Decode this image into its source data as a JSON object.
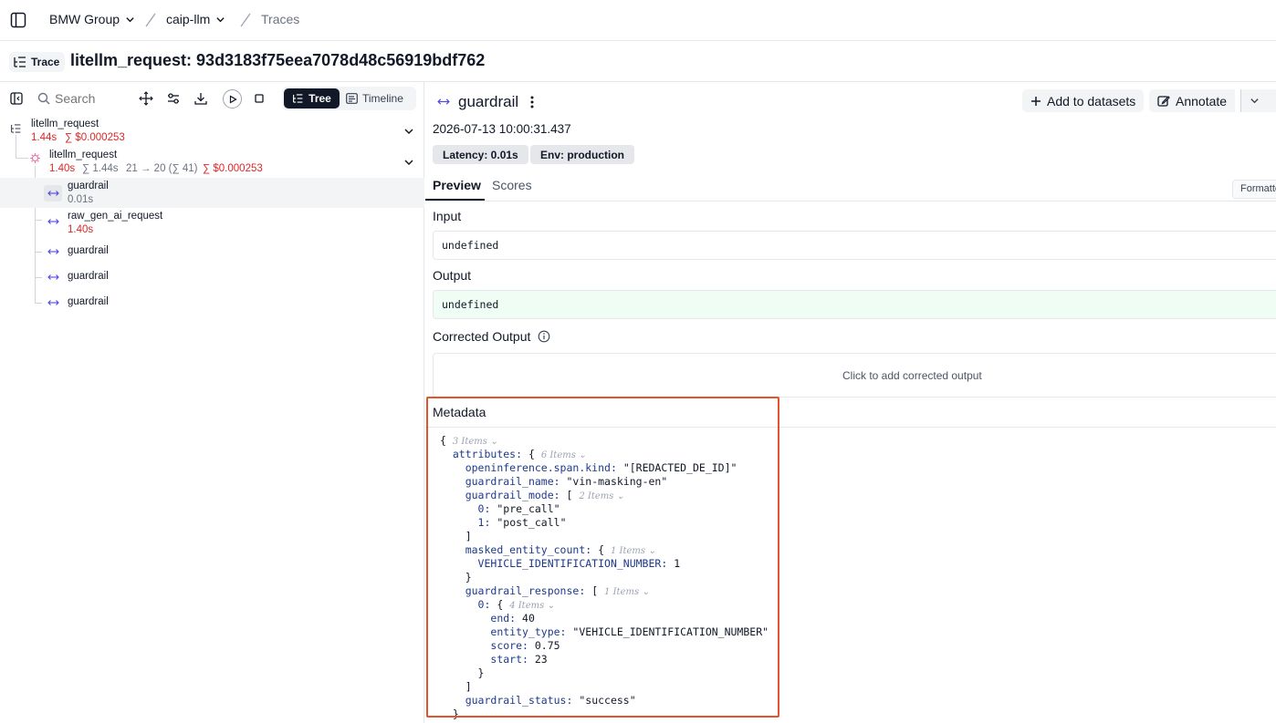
{
  "breadcrumb": {
    "org": "BMW Group",
    "project": "caip-llm",
    "page": "Traces"
  },
  "trace": {
    "badge": "Trace",
    "title": "litellm_request: 93d3183f75eea7078d48c56919bdf762"
  },
  "toolbar": {
    "search_placeholder": "Search",
    "tree_label": "Tree",
    "timeline_label": "Timeline"
  },
  "tree": {
    "root": {
      "name": "litellm_request",
      "latency": "1.44s",
      "cost": "∑ $0.000253"
    },
    "child": {
      "name": "litellm_request",
      "latency": "1.40s",
      "total_latency": "∑ 1.44s",
      "tokens": "21 → 20 (∑ 41)",
      "cost": "∑ $0.000253"
    },
    "spans": [
      {
        "name": "guardrail",
        "latency": "0.01s"
      },
      {
        "name": "raw_gen_ai_request",
        "latency": "1.40s"
      },
      {
        "name": "guardrail",
        "latency": ""
      },
      {
        "name": "guardrail",
        "latency": ""
      },
      {
        "name": "guardrail",
        "latency": ""
      }
    ]
  },
  "detail": {
    "span_name": "guardrail",
    "add_to_datasets": "Add to datasets",
    "annotate": "Annotate",
    "timestamp": "2026-07-13 10:00:31.437",
    "latency_chip": "Latency: 0.01s",
    "env_chip": "Env: production",
    "tabs": [
      "Preview",
      "Scores"
    ],
    "format_label": "Formatted",
    "input_label": "Input",
    "input_value": "undefined",
    "output_label": "Output",
    "output_value": "undefined",
    "corrected_label": "Corrected Output",
    "corrected_placeholder": "Click to add corrected output",
    "metadata_label": "Metadata"
  },
  "metadata": {
    "root_count": "3 Items",
    "attributes_key": "attributes:",
    "attributes_count": "6 Items",
    "span_kind_key": "openinference.span.kind:",
    "span_kind_val": "\"[REDACTED_DE_ID]\"",
    "guardrail_name_key": "guardrail_name:",
    "guardrail_name_val": "\"vin-masking-en\"",
    "guardrail_mode_key": "guardrail_mode:",
    "guardrail_mode_count": "2 Items",
    "mode_0_key": "0:",
    "mode_0_val": "\"pre_call\"",
    "mode_1_key": "1:",
    "mode_1_val": "\"post_call\"",
    "masked_key": "masked_entity_count:",
    "masked_count": "1 Items",
    "vin_key": "VEHICLE_IDENTIFICATION_NUMBER:",
    "vin_val": "1",
    "response_key": "guardrail_response:",
    "response_count": "1 Items",
    "resp_0_key": "0:",
    "resp_0_count": "4 Items",
    "end_key": "end:",
    "end_val": "40",
    "entity_type_key": "entity_type:",
    "entity_type_val": "\"VEHICLE_IDENTIFICATION_NUMBER\"",
    "score_key": "score:",
    "score_val": "0.75",
    "start_key": "start:",
    "start_val": "23",
    "status_key": "guardrail_status:",
    "status_val": "\"success\""
  },
  "colors": {
    "accent_red": "#dc2626",
    "highlight_border": "#e5532b",
    "span_icon": "#4f46e5"
  }
}
